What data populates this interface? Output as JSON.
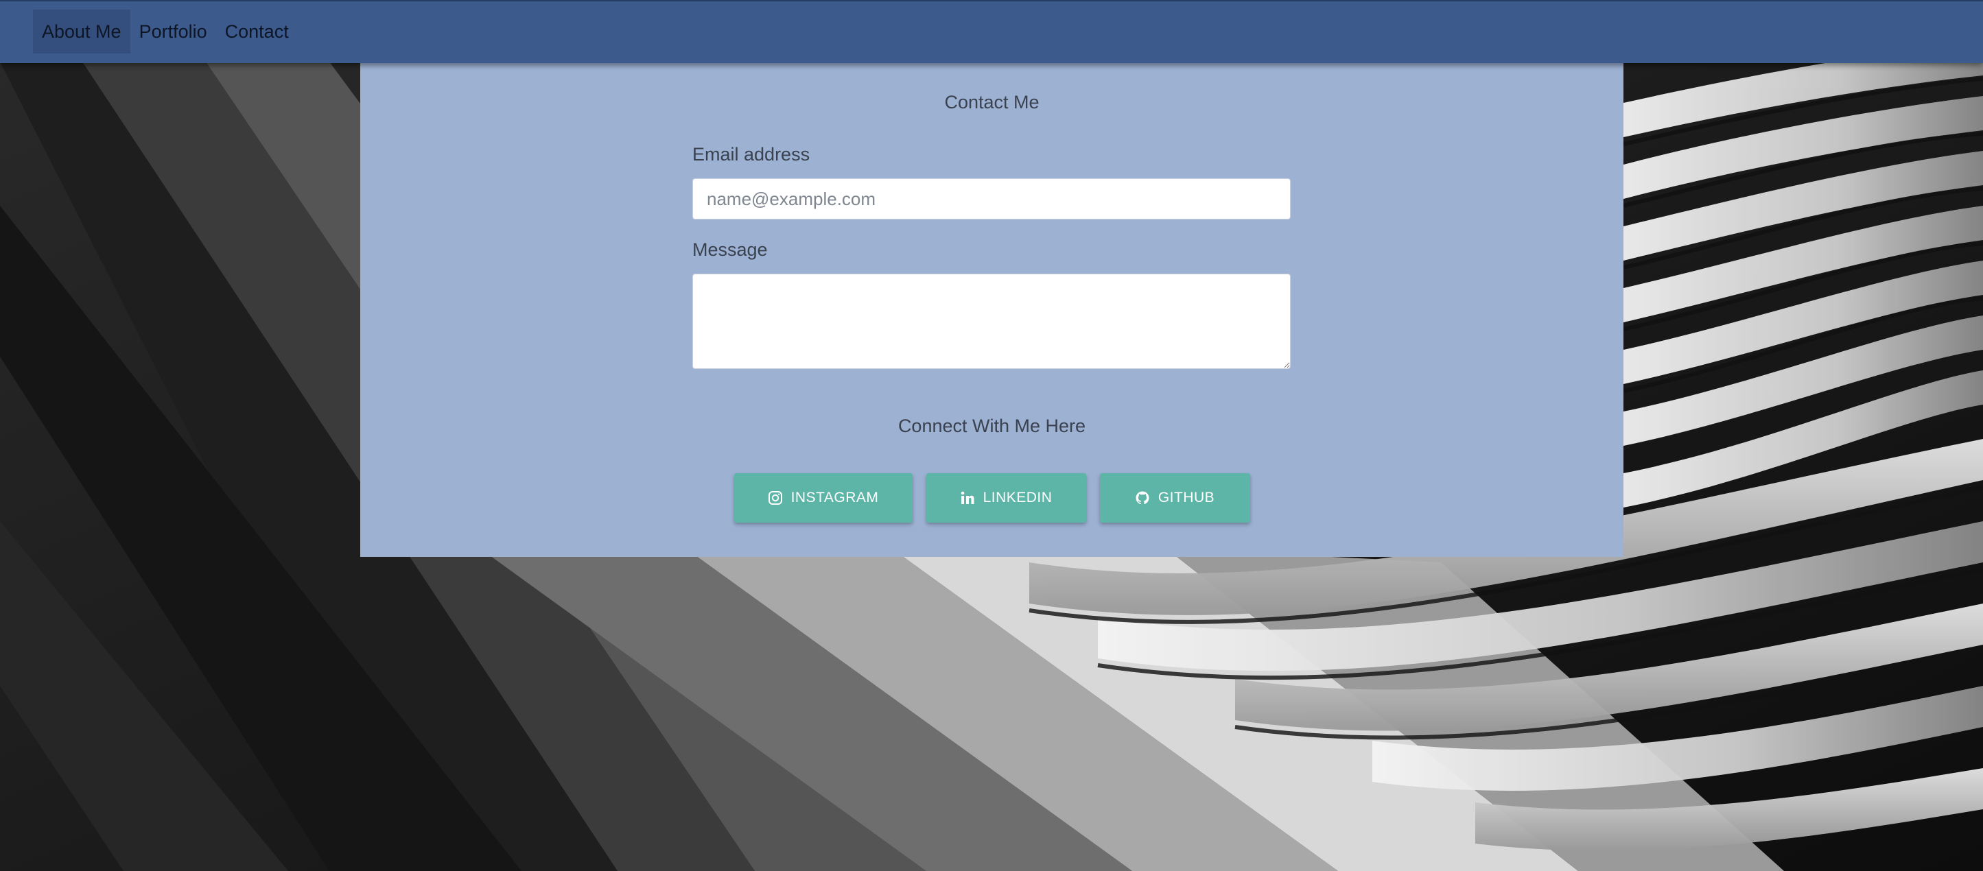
{
  "nav": {
    "items": [
      {
        "label": "About Me",
        "active": true
      },
      {
        "label": "Portfolio",
        "active": false
      },
      {
        "label": "Contact",
        "active": false
      }
    ]
  },
  "contact": {
    "title": "Contact Me",
    "email_label": "Email address",
    "email_placeholder": "name@example.com",
    "email_value": "",
    "message_label": "Message",
    "message_value": "",
    "connect_title": "Connect With Me Here",
    "socials": [
      {
        "label": "INSTAGRAM",
        "icon": "instagram-icon"
      },
      {
        "label": "LINKEDIN",
        "icon": "linkedin-icon"
      },
      {
        "label": "GITHUB",
        "icon": "github-icon"
      }
    ]
  },
  "colors": {
    "navbar": "#3c5a8c",
    "nav_active": "#344f7d",
    "card": "#9db1d3",
    "button": "#5db5a8"
  }
}
